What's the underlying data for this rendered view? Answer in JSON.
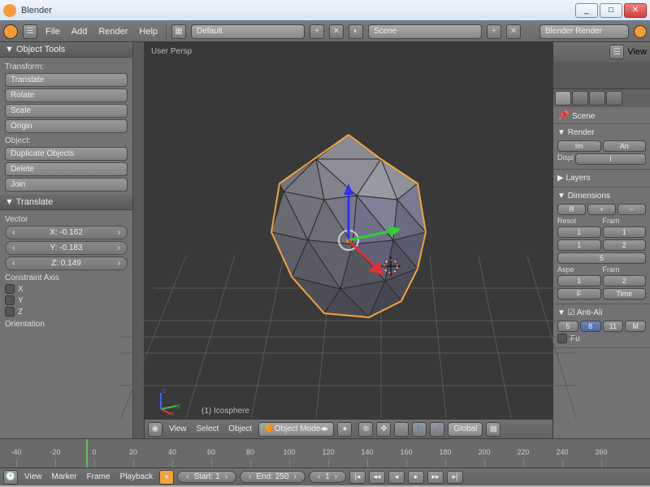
{
  "window": {
    "title": "Blender"
  },
  "menubar": {
    "items": [
      "File",
      "Add",
      "Render",
      "Help"
    ],
    "layout": "Default",
    "scene": "Scene",
    "engine": "Blender Render"
  },
  "object_tools": {
    "title": "Object Tools",
    "transform_label": "Transform:",
    "buttons": [
      "Translate",
      "Rotate",
      "Scale",
      "Origin"
    ],
    "object_label": "Object:",
    "object_buttons": [
      "Duplicate Objects",
      "Delete",
      "Join"
    ]
  },
  "translate_panel": {
    "title": "Translate",
    "vector_label": "Vector",
    "x": "X: -0.162",
    "y": "Y: -0.183",
    "z": "Z: 0.149",
    "constraint_label": "Constraint Axis",
    "axes": [
      "X",
      "Y",
      "Z"
    ],
    "orientation_label": "Orientation"
  },
  "viewport": {
    "persp": "User Persp",
    "object_name": "(1) Icosphere",
    "header": {
      "menus": [
        "View",
        "Select",
        "Object"
      ],
      "mode": "Object Mode",
      "orientation": "Global"
    }
  },
  "right": {
    "view_label": "View",
    "breadcrumb": "Scene",
    "panels": {
      "render": "Render",
      "render_btns": [
        "Im",
        "An"
      ],
      "display": "Displ",
      "display_val": "I",
      "layers": "Layers",
      "dimensions": "Dimensions",
      "preset": "R",
      "resol": "Resol",
      "fram": "Fram",
      "resol_vals": [
        "1",
        "1",
        "5"
      ],
      "fram_vals": [
        "1",
        "2"
      ],
      "aspect": "Aspe",
      "fram2": "Fram",
      "aspe_vals": [
        "1",
        "F"
      ],
      "fram2_vals": [
        "2",
        "Time"
      ],
      "antialias": "Anti-Ali",
      "aa_vals": [
        "5",
        "8",
        "11"
      ],
      "aa_m": "M",
      "fu": "Fu"
    }
  },
  "timeline": {
    "ticks": [
      "-40",
      "-20",
      "0",
      "20",
      "40",
      "60",
      "80",
      "100",
      "120",
      "140",
      "160",
      "180",
      "200",
      "220",
      "240",
      "260"
    ],
    "menus": [
      "View",
      "Marker",
      "Frame",
      "Playback"
    ],
    "start": "Start: 1",
    "end": "End: 250",
    "current": "1"
  }
}
